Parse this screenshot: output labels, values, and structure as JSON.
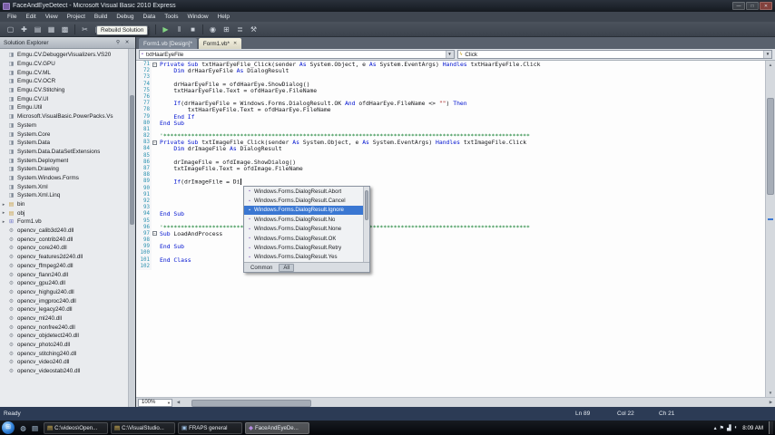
{
  "window": {
    "title": "FaceAndEyeDetect - Microsoft Visual Basic 2010 Express",
    "controls": {
      "minimize": "—",
      "maximize": "□",
      "close": "✕"
    }
  },
  "menu": {
    "items": [
      "File",
      "Edit",
      "View",
      "Project",
      "Build",
      "Debug",
      "Data",
      "Tools",
      "Window",
      "Help"
    ]
  },
  "toolbar": {
    "tooltip": "Rebuild Solution",
    "icons": [
      {
        "name": "new-project-icon",
        "glyph": "▢"
      },
      {
        "name": "add-item-icon",
        "glyph": "✚"
      },
      {
        "name": "open-file-icon",
        "glyph": "▤"
      },
      {
        "name": "save-icon",
        "glyph": "▦"
      },
      {
        "name": "save-all-icon",
        "glyph": "▩"
      },
      {
        "sep": true
      },
      {
        "name": "cut-icon",
        "glyph": "✂"
      },
      {
        "name": "copy-icon",
        "glyph": "▣"
      },
      {
        "name": "paste-icon",
        "glyph": "▥"
      },
      {
        "sep": true
      },
      {
        "name": "undo-icon",
        "glyph": "↶"
      },
      {
        "name": "redo-icon",
        "glyph": "↷"
      },
      {
        "sep": true
      },
      {
        "name": "start-debug-icon",
        "glyph": "▶",
        "color": "#83d683"
      },
      {
        "name": "break-all-icon",
        "glyph": "‖"
      },
      {
        "name": "stop-debug-icon",
        "glyph": "■"
      },
      {
        "sep": true
      },
      {
        "name": "find-icon",
        "glyph": "◉"
      },
      {
        "name": "solution-explorer-icon",
        "glyph": "⊞"
      },
      {
        "name": "properties-window-icon",
        "glyph": "≣"
      },
      {
        "name": "toolbox-icon",
        "glyph": "⚒"
      }
    ]
  },
  "solution_explorer": {
    "title": "Solution Explorer",
    "items": [
      {
        "label": "Emgu.CV.DebuggerVisualizers.VS20",
        "type": "reference"
      },
      {
        "label": "Emgu.CV.GPU",
        "type": "reference"
      },
      {
        "label": "Emgu.CV.ML",
        "type": "reference"
      },
      {
        "label": "Emgu.CV.OCR",
        "type": "reference"
      },
      {
        "label": "Emgu.CV.Stitching",
        "type": "reference"
      },
      {
        "label": "Emgu.CV.UI",
        "type": "reference"
      },
      {
        "label": "Emgu.Util",
        "type": "reference"
      },
      {
        "label": "Microsoft.VisualBasic.PowerPacks.Vs",
        "type": "reference"
      },
      {
        "label": "System",
        "type": "reference"
      },
      {
        "label": "System.Core",
        "type": "reference"
      },
      {
        "label": "System.Data",
        "type": "reference"
      },
      {
        "label": "System.Data.DataSetExtensions",
        "type": "reference"
      },
      {
        "label": "System.Deployment",
        "type": "reference"
      },
      {
        "label": "System.Drawing",
        "type": "reference"
      },
      {
        "label": "System.Windows.Forms",
        "type": "reference"
      },
      {
        "label": "System.Xml",
        "type": "reference"
      },
      {
        "label": "System.Xml.Linq",
        "type": "reference"
      },
      {
        "label": "bin",
        "type": "folder",
        "arrow": true
      },
      {
        "label": "obj",
        "type": "folder",
        "arrow": true
      },
      {
        "label": "Form1.vb",
        "type": "form",
        "arrow": true
      },
      {
        "label": "opencv_calib3d240.dll",
        "type": "dll"
      },
      {
        "label": "opencv_contrib240.dll",
        "type": "dll"
      },
      {
        "label": "opencv_core240.dll",
        "type": "dll"
      },
      {
        "label": "opencv_features2d240.dll",
        "type": "dll"
      },
      {
        "label": "opencv_ffmpeg240.dll",
        "type": "dll"
      },
      {
        "label": "opencv_flann240.dll",
        "type": "dll"
      },
      {
        "label": "opencv_gpu240.dll",
        "type": "dll"
      },
      {
        "label": "opencv_highgui240.dll",
        "type": "dll"
      },
      {
        "label": "opencv_imgproc240.dll",
        "type": "dll"
      },
      {
        "label": "opencv_legacy240.dll",
        "type": "dll"
      },
      {
        "label": "opencv_ml240.dll",
        "type": "dll"
      },
      {
        "label": "opencv_nonfree240.dll",
        "type": "dll"
      },
      {
        "label": "opencv_objdetect240.dll",
        "type": "dll"
      },
      {
        "label": "opencv_photo240.dll",
        "type": "dll"
      },
      {
        "label": "opencv_stitching240.dll",
        "type": "dll"
      },
      {
        "label": "opencv_video240.dll",
        "type": "dll"
      },
      {
        "label": "opencv_videostab240.dll",
        "type": "dll"
      }
    ]
  },
  "editor": {
    "tabs": [
      {
        "label": "Form1.vb [Design]*",
        "active": false
      },
      {
        "label": "Form1.vb*",
        "active": true
      }
    ],
    "nav": {
      "object": "txtHaarEyeFile",
      "event": "Click"
    },
    "zoom": "100%",
    "lines": [
      {
        "n": 71,
        "t": "Private Sub txtHaarEyeFile_Click(sender As System.Object, e As System.EventArgs) Handles txtHaarEyeFile.Click",
        "fold": true
      },
      {
        "n": 72,
        "t": "    Dim drHaarEyeFile As DialogResult"
      },
      {
        "n": 73,
        "t": ""
      },
      {
        "n": 74,
        "t": "    drHaarEyeFile = ofdHaarEye.ShowDialog()"
      },
      {
        "n": 75,
        "t": "    txtHaarEyeFile.Text = ofdHaarEye.FileName"
      },
      {
        "n": 76,
        "t": ""
      },
      {
        "n": 77,
        "t": "    If(drHaarEyeFile = Windows.Forms.DialogResult.OK And ofdHaarEye.FileName <> \"\") Then"
      },
      {
        "n": 78,
        "t": "        txtHaarEyeFile.Text = ofdHaarEye.FileName"
      },
      {
        "n": 79,
        "t": "    End If"
      },
      {
        "n": 80,
        "t": "End Sub"
      },
      {
        "n": 81,
        "t": ""
      },
      {
        "n": 82,
        "t": "'*********************************************************************************************************"
      },
      {
        "n": 83,
        "t": "Private Sub txtImageFile_Click(sender As System.Object, e As System.EventArgs) Handles txtImageFile.Click",
        "fold": true
      },
      {
        "n": 84,
        "t": "    Dim drImageFile As DialogResult"
      },
      {
        "n": 85,
        "t": ""
      },
      {
        "n": 86,
        "t": "    drImageFile = ofdImage.ShowDialog()"
      },
      {
        "n": 87,
        "t": "    txtImageFile.Text = ofdImage.FileName"
      },
      {
        "n": 88,
        "t": ""
      },
      {
        "n": 89,
        "t": "    If(drImageFile = Di",
        "caret": true
      },
      {
        "n": 90,
        "t": ""
      },
      {
        "n": 91,
        "t": ""
      },
      {
        "n": 92,
        "t": ""
      },
      {
        "n": 93,
        "t": ""
      },
      {
        "n": 94,
        "t": "End Sub"
      },
      {
        "n": 95,
        "t": ""
      },
      {
        "n": 96,
        "t": "'*********************************************************************************************************"
      },
      {
        "n": 97,
        "t": "Sub LoadAndProcess",
        "fold": true
      },
      {
        "n": 98,
        "t": ""
      },
      {
        "n": 99,
        "t": "End Sub"
      },
      {
        "n": 100,
        "t": ""
      },
      {
        "n": 101,
        "t": "End Class"
      },
      {
        "n": 102,
        "t": ""
      }
    ]
  },
  "intellisense": {
    "items": [
      {
        "label": "Windows.Forms.DialogResult.Abort"
      },
      {
        "label": "Windows.Forms.DialogResult.Cancel"
      },
      {
        "label": "Windows.Forms.DialogResult.Ignore",
        "selected": true
      },
      {
        "label": "Windows.Forms.DialogResult.No"
      },
      {
        "label": "Windows.Forms.DialogResult.None"
      },
      {
        "label": "Windows.Forms.DialogResult.OK"
      },
      {
        "label": "Windows.Forms.DialogResult.Retry"
      },
      {
        "label": "Windows.Forms.DialogResult.Yes"
      }
    ],
    "tabs": [
      "Common",
      "All"
    ],
    "active_tab": "All"
  },
  "status": {
    "ready": "Ready",
    "ln": "Ln 89",
    "col": "Col 22",
    "ch": "Ch 21"
  },
  "taskbar": {
    "pinned": [
      {
        "name": "pinned-app-icon-1",
        "glyph": "◍"
      },
      {
        "name": "pinned-app-icon-2",
        "glyph": "▤"
      }
    ],
    "tasks": [
      {
        "label": "C:\\videos\\Open...",
        "glyph": "▤",
        "color": "#e8c35a",
        "active": false
      },
      {
        "label": "C:\\VisualStudio...",
        "glyph": "▤",
        "color": "#e8c35a",
        "active": false
      },
      {
        "label": "FRAPS general",
        "glyph": "▣",
        "color": "#9fc3e8",
        "active": false
      },
      {
        "label": "FaceAndEyeDe...",
        "glyph": "◆",
        "color": "#b48ce0",
        "active": true
      }
    ],
    "tray_icons": [
      {
        "name": "hidden-icons-icon",
        "glyph": "▴"
      },
      {
        "name": "action-center-icon",
        "glyph": "⚑"
      },
      {
        "name": "network-icon",
        "glyph": "▟"
      },
      {
        "name": "volume-icon",
        "glyph": "◖"
      }
    ],
    "clock": "8:09 AM"
  },
  "colors": {
    "accent_blue": "#3a77d2",
    "keyword": "#0012d0",
    "comment": "#0a7a28",
    "line_number": "#2b91af",
    "status_bg": "#2c3b55"
  }
}
